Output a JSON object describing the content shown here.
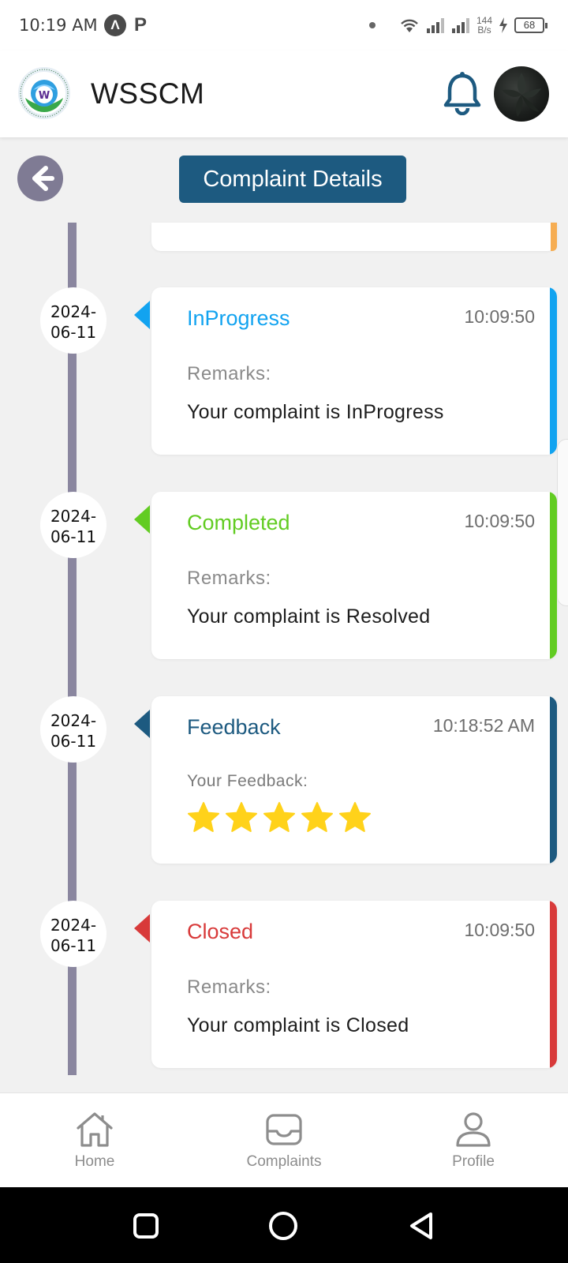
{
  "status_bar": {
    "time": "10:19 AM",
    "badge_a": "Λ",
    "badge_p": "P",
    "net_speed_value": "144",
    "net_speed_unit": "B/s",
    "battery": "68"
  },
  "header": {
    "app_title": "WSSCM",
    "icons": [
      "logo-icon",
      "bell-icon",
      "avatar"
    ]
  },
  "page": {
    "title": "Complaint Details",
    "back_icon": "arrow-left-icon"
  },
  "timeline": [
    {
      "date_line1": "2024-",
      "date_line2": "06-11",
      "status": "InProgress",
      "time": "10:09:50",
      "label": "Remarks:",
      "text": "Your complaint is InProgress",
      "color": "#12a3f0"
    },
    {
      "date_line1": "2024-",
      "date_line2": "06-11",
      "status": "Completed",
      "time": "10:09:50",
      "label": "Remarks:",
      "text": "Your complaint is Resolved",
      "color": "#62cc22"
    },
    {
      "date_line1": "2024-",
      "date_line2": "06-11",
      "status": "Feedback",
      "time": "10:18:52 AM",
      "label": "Your Feedback:",
      "rating": 5,
      "color": "#1d5a80"
    },
    {
      "date_line1": "2024-",
      "date_line2": "06-11",
      "status": "Closed",
      "time": "10:09:50",
      "label": "Remarks:",
      "text": "Your complaint is Closed",
      "color": "#d83a3a"
    }
  ],
  "previous_card_color": "#f6ad52",
  "bottom_nav": {
    "home": "Home",
    "complaints": "Complaints",
    "profile": "Profile"
  },
  "colors": {
    "primary": "#1d5a80",
    "timeline": "#8a869f",
    "star": "#ffd21a"
  }
}
